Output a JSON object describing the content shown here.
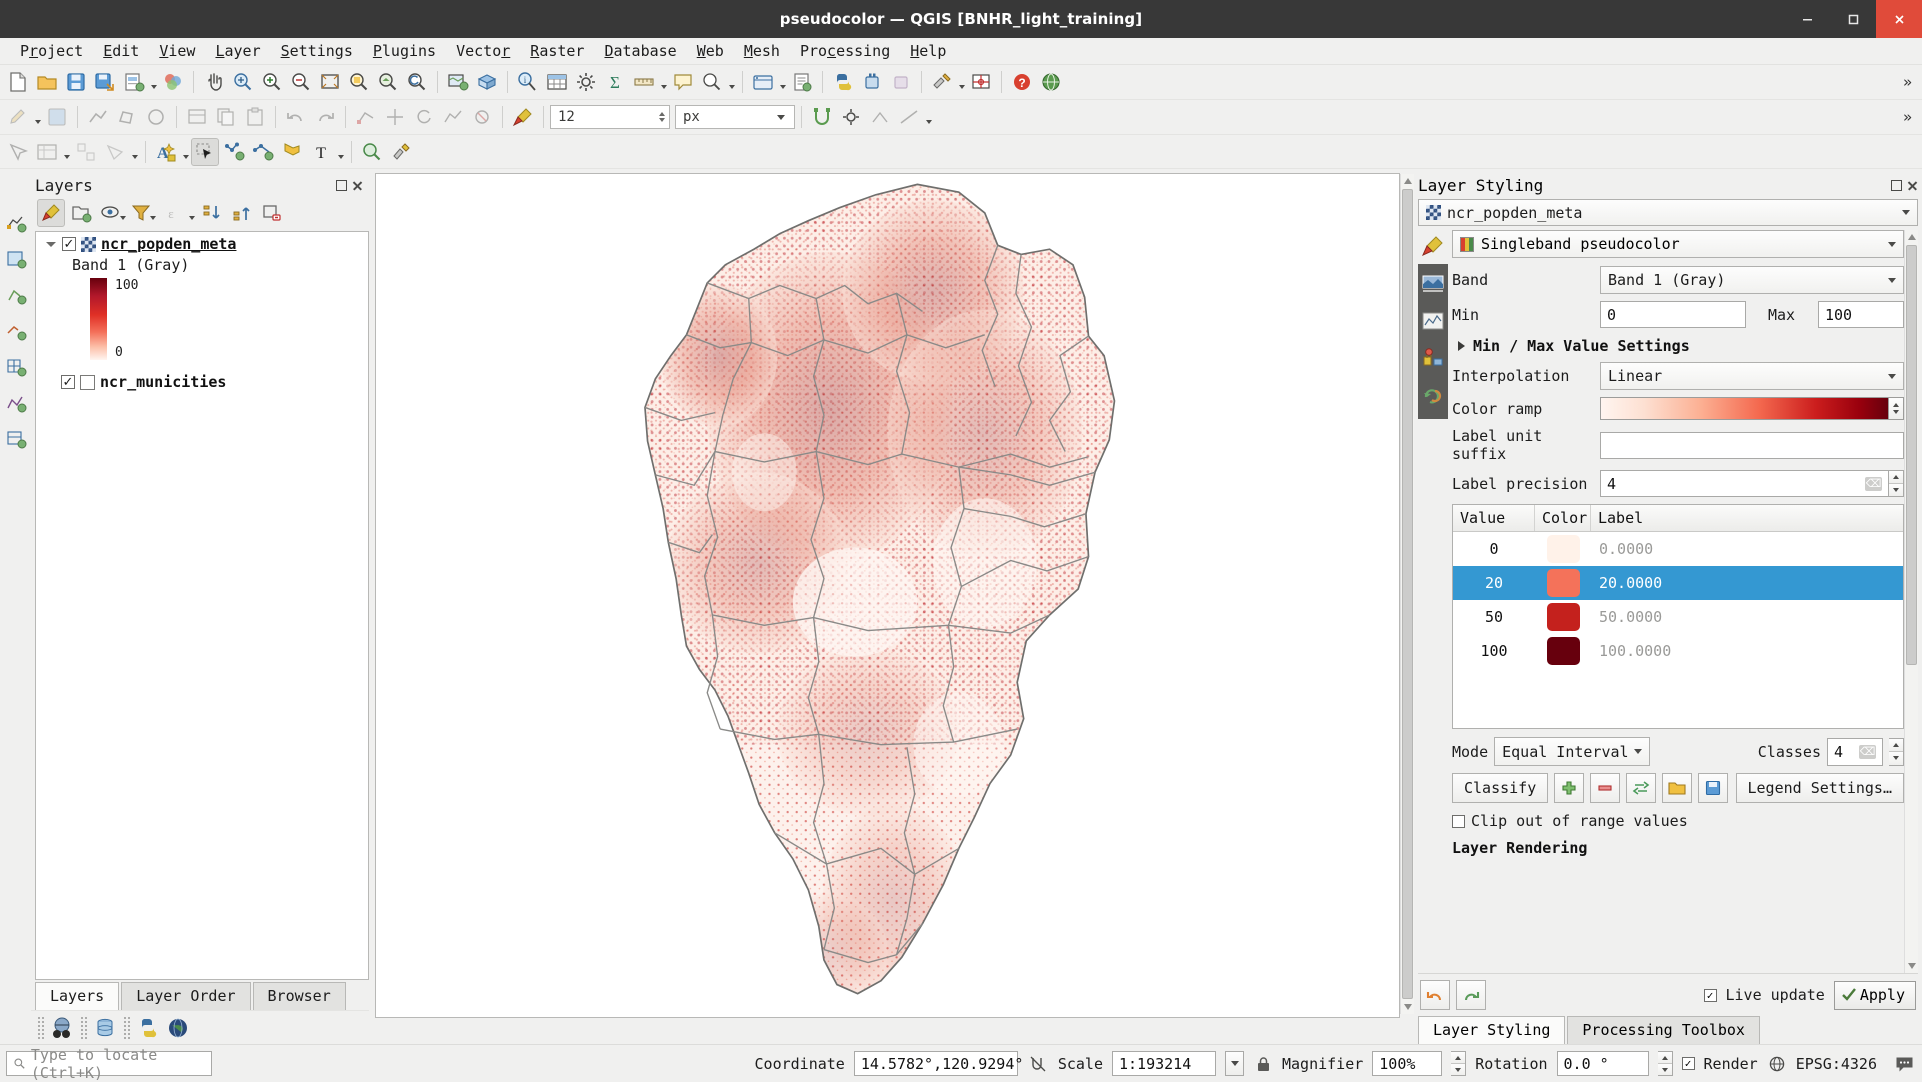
{
  "window": {
    "title": "pseudocolor — QGIS [BNHR_light_training]",
    "minimize": "—",
    "maximize": "▢",
    "close": "✕"
  },
  "menubar": {
    "items": [
      "Project",
      "Edit",
      "View",
      "Layer",
      "Settings",
      "Plugins",
      "Vector",
      "Raster",
      "Database",
      "Web",
      "Mesh",
      "Processing",
      "Help"
    ]
  },
  "toolbar": {
    "font_size": "12",
    "font_unit": "px",
    "overflow": "»"
  },
  "layers_panel": {
    "title": "Layers",
    "toolbar_icons": [
      "open-layer-styling-panel-icon",
      "add-group-icon",
      "manage-map-themes-icon",
      "filter-legend-icon",
      "filter-legend-by-expression-icon",
      "expand-all-icon",
      "collapse-all-icon",
      "remove-layer-icon"
    ],
    "tree": [
      {
        "name": "ncr_popden_meta",
        "checked": true,
        "type": "raster",
        "band_label": "Band 1 (Gray)",
        "legend_max": "100",
        "legend_min": "0"
      },
      {
        "name": "ncr_municities",
        "checked": true,
        "type": "vector"
      }
    ],
    "tabs": [
      {
        "label": "Layers",
        "active": true
      },
      {
        "label": "Layer Order",
        "active": false
      },
      {
        "label": "Browser",
        "active": false
      }
    ]
  },
  "style_dock": {
    "title": "Layer Styling",
    "layer_selector": "ncr_popden_meta",
    "renderer": "Singleband pseudocolor",
    "band_label": "Band",
    "band_value": "Band 1 (Gray)",
    "min_label": "Min",
    "min_value": "0",
    "max_label": "Max",
    "max_value": "100",
    "minmax_settings": "Min / Max Value Settings",
    "interpolation_label": "Interpolation",
    "interpolation_value": "Linear",
    "color_ramp_label": "Color ramp",
    "label_unit_suffix_label": "Label unit suffix",
    "label_unit_suffix_value": "",
    "label_precision_label": "Label precision",
    "label_precision_value": "4",
    "table": {
      "headers": [
        "Value",
        "Color",
        "Label"
      ],
      "rows": [
        {
          "value": "0",
          "color": "#fff2e9",
          "label": "0.0000",
          "selected": false
        },
        {
          "value": "20",
          "color": "#f4725a",
          "label": "20.0000",
          "selected": true
        },
        {
          "value": "50",
          "color": "#c4211d",
          "label": "50.0000",
          "selected": false
        },
        {
          "value": "100",
          "color": "#67000d",
          "label": "100.0000",
          "selected": false
        }
      ]
    },
    "mode_label": "Mode",
    "mode_value": "Equal Interval",
    "classes_label": "Classes",
    "classes_value": "4",
    "classify_label": "Classify",
    "legend_settings_label": "Legend Settings…",
    "clip_label": "Clip out of range values",
    "clip_checked": false,
    "layer_rendering_label": "Layer Rendering",
    "live_update_label": "Live update",
    "live_update_checked": true,
    "apply_label": "Apply",
    "undo_icon": "undo-icon",
    "redo_icon": "redo-icon",
    "tabs": [
      {
        "label": "Layer Styling",
        "active": true
      },
      {
        "label": "Processing Toolbox",
        "active": false
      }
    ]
  },
  "statusbar": {
    "locate_placeholder": "Type to locate (Ctrl+K)",
    "coordinate_label": "Coordinate",
    "coordinate_value": "14.5782°,120.9294°",
    "scale_label": "Scale",
    "scale_value": "1:193214",
    "magnifier_label": "Magnifier",
    "magnifier_value": "100%",
    "rotation_label": "Rotation",
    "rotation_value": "0.0 °",
    "render_label": "Render",
    "render_checked": true,
    "crs_label": "EPSG:4326"
  },
  "colors": {
    "selection_blue": "#3498d2",
    "titlebar": "#383838",
    "close_red": "#e04b3a",
    "ramp_min": "#fff5f0",
    "ramp_max": "#67000d"
  }
}
